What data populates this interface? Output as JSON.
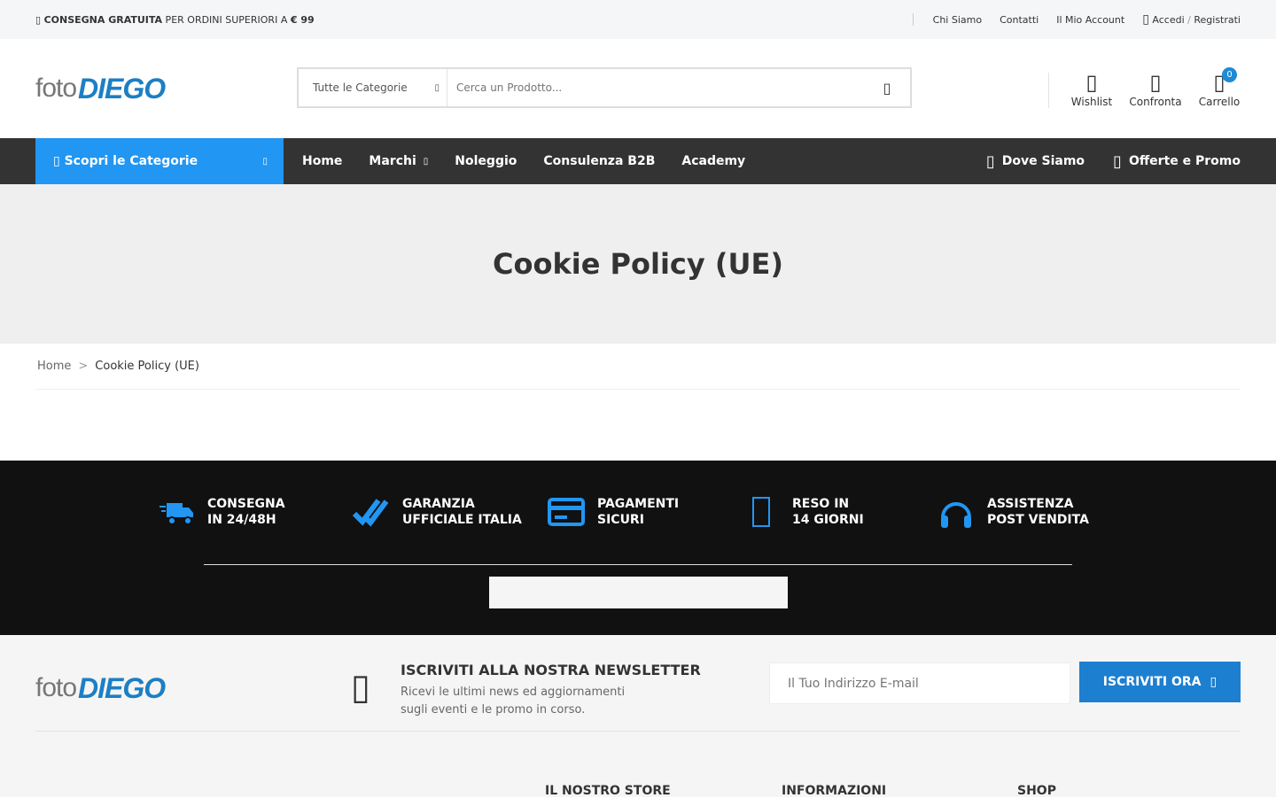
{
  "topbar": {
    "promo_bold": "CONSEGNA GRATUITA",
    "promo_text": " PER ORDINI SUPERIORI A ",
    "promo_amount": "€ 99",
    "links": [
      "Chi Siamo",
      "Contatti",
      "Il Mio Account"
    ],
    "login": "Accedi",
    "slash": "/",
    "register": "Registrati"
  },
  "logo": {
    "foto": "foto",
    "diego": "DIEGO"
  },
  "search": {
    "category": "Tutte le Categorie",
    "placeholder": "Cerca un Prodotto..."
  },
  "header_icons": {
    "wishlist": "Wishlist",
    "compare": "Confronta",
    "cart": "Carrello",
    "cart_count": "0"
  },
  "nav": {
    "discover": "Scopri le Categorie",
    "items": [
      "Home",
      "Marchi",
      "Noleggio",
      "Consulenza B2B",
      "Academy"
    ],
    "right": [
      "Dove Siamo",
      "Offerte e Promo"
    ]
  },
  "hero": {
    "title": "Cookie Policy (UE)"
  },
  "breadcrumb": {
    "home": "Home",
    "sep": ">",
    "current": "Cookie Policy (UE)"
  },
  "features": [
    {
      "line1": "CONSEGNA",
      "line2": "IN 24/48H",
      "icon": "truck-icon"
    },
    {
      "line1": "GARANZIA",
      "line2": "UFFICIALE ITALIA",
      "icon": "double-check-icon"
    },
    {
      "line1": "PAGAMENTI",
      "line2": "SICURI",
      "icon": "credit-card-icon"
    },
    {
      "line1": "RESO IN",
      "line2": "14 GIORNI",
      "icon": "return-icon"
    },
    {
      "line1": "ASSISTENZA",
      "line2": "POST VENDITA",
      "icon": "headphones-icon"
    }
  ],
  "newsletter": {
    "title": "ISCRIVITI ALLA NOSTRA NEWSLETTER",
    "line1": "Ricevi le ultimi news ed aggiornamenti",
    "line2": "sugli eventi e le promo in corso.",
    "placeholder": "Il Tuo Indirizzo E-mail",
    "button": "ISCRIVITI ORA"
  },
  "footer_cols": [
    "IL NOSTRO STORE",
    "INFORMAZIONI",
    "SHOP"
  ],
  "colors": {
    "accent": "#2196f3",
    "brand": "#1d7fc4",
    "dark": "#333333",
    "black": "#111111"
  }
}
